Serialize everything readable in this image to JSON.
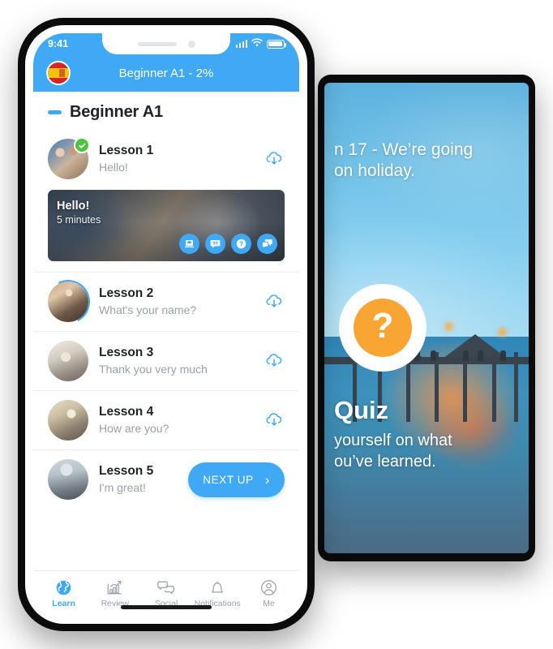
{
  "phone": {
    "status_bar": {
      "time": "9:41",
      "signal_icon": "signal-bars-icon",
      "wifi_icon": "wifi-icon",
      "battery_icon": "battery-icon"
    },
    "header": {
      "flag_icon": "spanish-flag-icon",
      "title": "Beginner A1 - 2%"
    },
    "section": {
      "collapse_icon": "collapse-minus-icon",
      "title": "Beginner A1"
    },
    "lessons": [
      {
        "title": "Lesson 1",
        "subtitle": "Hello!",
        "avatar": "lesson-1-photo",
        "status": "completed",
        "badge_icon": "check-badge-icon",
        "download_icon": "cloud-download-icon",
        "expanded": true
      },
      {
        "title": "Lesson 2",
        "subtitle": "What's your name?",
        "avatar": "lesson-2-photo",
        "status": "in-progress",
        "download_icon": "cloud-download-icon",
        "expanded": false
      },
      {
        "title": "Lesson 3",
        "subtitle": "Thank you very much",
        "avatar": "lesson-3-photo",
        "status": "not-started",
        "download_icon": "cloud-download-icon",
        "expanded": false
      },
      {
        "title": "Lesson 4",
        "subtitle": "How are you?",
        "avatar": "lesson-4-photo",
        "status": "not-started",
        "download_icon": "cloud-download-icon",
        "expanded": false
      },
      {
        "title": "Lesson 5",
        "subtitle": "I'm great!",
        "avatar": "lesson-5-photo",
        "status": "next-up",
        "expanded": false
      }
    ],
    "lesson_card": {
      "title": "Hello!",
      "duration": "5 minutes",
      "actions": [
        {
          "icon": "video-lesson-icon",
          "label": "Video"
        },
        {
          "icon": "vocabulary-quote-icon",
          "label": "Vocabulary"
        },
        {
          "icon": "quiz-question-icon",
          "label": "Quiz"
        },
        {
          "icon": "conversation-chat-icon",
          "label": "Conversation"
        }
      ]
    },
    "next_up_button": {
      "label": "NEXT UP",
      "chevron_icon": "chevron-right-icon"
    },
    "tabs": [
      {
        "label": "Learn",
        "icon": "globe-icon",
        "active": true
      },
      {
        "label": "Review",
        "icon": "bar-chart-icon",
        "active": false
      },
      {
        "label": "Social",
        "icon": "chat-bubbles-icon",
        "active": false
      },
      {
        "label": "Notifications",
        "icon": "bell-icon",
        "active": false
      },
      {
        "label": "Me",
        "icon": "person-icon",
        "active": false
      }
    ]
  },
  "tablet": {
    "heading": "n 17 - We’re going\non holiday.",
    "quiz_icon": "question-mark-icon",
    "quiz_title": "Quiz",
    "quiz_subtitle": " yourself on what\nou’ve learned."
  },
  "colors": {
    "brand_blue": "#3FA9F5",
    "success_green": "#4CC23F",
    "quiz_orange": "#F9A533",
    "text_primary": "#1F2227",
    "text_muted": "#9AA1A8"
  }
}
